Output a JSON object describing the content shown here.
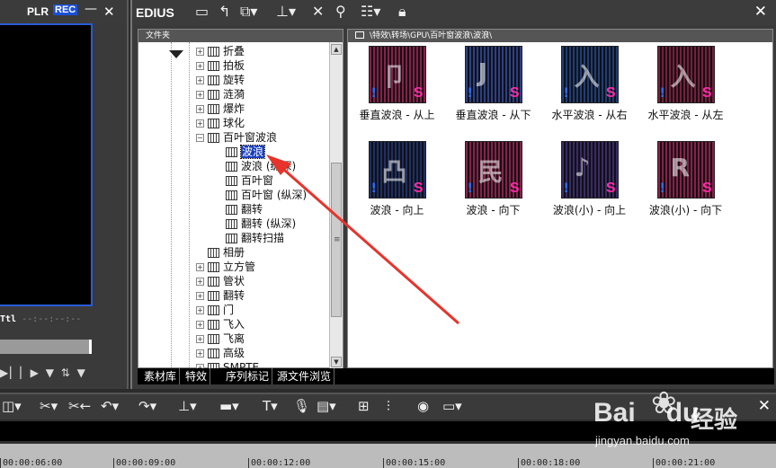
{
  "player": {
    "plr": "PLR",
    "rec": "REC",
    "minimize": "—",
    "close": "✕",
    "timecode_label": "Ttl",
    "timecode_value": "--:--:--:--",
    "controls": "▶▏▏▶ ▼ ⇅ ▼"
  },
  "edius": {
    "brand": "EDIUS",
    "close": "✕",
    "folder_pane_header": "文件夹",
    "path": "\\特效\\转场\\GPU\\百叶窗波浪\\波浪\\",
    "tree": [
      {
        "label": "折叠",
        "expander": "+",
        "selected": false
      },
      {
        "label": "拍板",
        "expander": "+",
        "selected": false
      },
      {
        "label": "旋转",
        "expander": "+",
        "selected": false
      },
      {
        "label": "涟漪",
        "expander": "+",
        "selected": false
      },
      {
        "label": "爆炸",
        "expander": "+",
        "selected": false
      },
      {
        "label": "球化",
        "expander": "+",
        "selected": false
      },
      {
        "label": "百叶窗波浪",
        "expander": "−",
        "selected": false
      },
      {
        "label": "波浪",
        "expander": "",
        "selected": true
      },
      {
        "label": "波浪 (纵深)",
        "expander": "",
        "selected": false
      },
      {
        "label": "百叶窗",
        "expander": "",
        "selected": false
      },
      {
        "label": "百叶窗 (纵深)",
        "expander": "",
        "selected": false
      },
      {
        "label": "翻转",
        "expander": "",
        "selected": false
      },
      {
        "label": "翻转 (纵深)",
        "expander": "",
        "selected": false
      },
      {
        "label": "翻转扫描",
        "expander": "",
        "selected": false
      },
      {
        "label": "相册",
        "expander": "",
        "selected": false
      },
      {
        "label": "立方管",
        "expander": "+",
        "selected": false
      },
      {
        "label": "管状",
        "expander": "+",
        "selected": false
      },
      {
        "label": "翻转",
        "expander": "+",
        "selected": false
      },
      {
        "label": "门",
        "expander": "+",
        "selected": false
      },
      {
        "label": "飞入",
        "expander": "+",
        "selected": false
      },
      {
        "label": "飞离",
        "expander": "+",
        "selected": false
      },
      {
        "label": "高级",
        "expander": "+",
        "selected": false
      },
      {
        "label": "SMPTE",
        "expander": "+",
        "selected": false
      }
    ],
    "effects": [
      {
        "label": "垂直波浪 - 从上",
        "bg": "#8a1f4a",
        "glyph": "卩"
      },
      {
        "label": "垂直波浪 - 从下",
        "bg": "#2b3f8a",
        "glyph": "J"
      },
      {
        "label": "水平波浪 - 从右",
        "bg": "#1d3d7a",
        "glyph": "入"
      },
      {
        "label": "水平波浪 - 从左",
        "bg": "#7a1d3d",
        "glyph": "入"
      },
      {
        "label": "波浪 - 向上",
        "bg": "#1d2f6a",
        "glyph": "凸"
      },
      {
        "label": "波浪 - 向下",
        "bg": "#8a1f4a",
        "glyph": "民"
      },
      {
        "label": "波浪(小) - 向上",
        "bg": "#3a2a6a",
        "glyph": "♪"
      },
      {
        "label": "波浪(小) - 向下",
        "bg": "#8a1f4a",
        "glyph": "R"
      }
    ],
    "tabs": [
      "素材库",
      "特效",
      "序列标记",
      "源文件浏览"
    ]
  },
  "timeline": {
    "close": "✕",
    "ruler": [
      "00:00:06:00",
      "00:00:09:00",
      "00:00:12:00",
      "00:00:15:00",
      "00:00:18:00",
      "00:00:21:00"
    ]
  },
  "watermark": {
    "logo": "Bai",
    "logo_suffix": "du",
    "chinese": "经验",
    "url": "jingyan.baidu.com"
  },
  "colors": {
    "selection": "#1a3fbf",
    "arrow": "#e8332a",
    "rec_badge": "#1b4fd6"
  }
}
